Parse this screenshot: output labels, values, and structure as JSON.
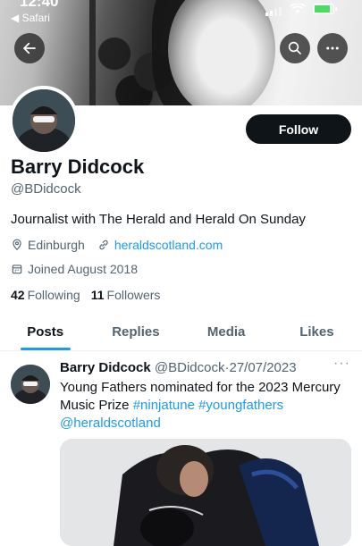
{
  "status_bar": {
    "time": "12:40",
    "back_app": "◀ Safari",
    "battery_color": "#4cd964"
  },
  "header": {
    "back_icon": "arrow-left-icon",
    "search_icon": "search-icon",
    "more_icon": "more-horizontal-icon"
  },
  "profile": {
    "name": "Barry Didcock",
    "handle": "@BDidcock",
    "bio": "Journalist with The Herald and Herald On Sunday",
    "location": "Edinburgh",
    "website": "heraldscotland.com",
    "joined": "Joined August 2018",
    "following_count": "42",
    "following_label": "Following",
    "followers_count": "11",
    "followers_label": "Followers",
    "follow_label": "Follow"
  },
  "tabs": [
    {
      "label": "Posts",
      "active": true
    },
    {
      "label": "Replies",
      "active": false
    },
    {
      "label": "Media",
      "active": false
    },
    {
      "label": "Likes",
      "active": false
    }
  ],
  "tweet": {
    "author_name": "Barry Didcock",
    "author_handle": "@BDidcock",
    "separator": "·",
    "date": "27/07/2023",
    "more": "···",
    "text_1": "Young Fathers nominated for the 2023 Mercury Music Prize ",
    "tag_1": "#ninjatune",
    "tag_2": "#youngfathers",
    "tag_3": "@heraldscotland"
  },
  "colors": {
    "accent": "#1d9bf0",
    "text_primary": "#0f1419",
    "text_secondary": "#536471",
    "button_dark": "#0f1419"
  }
}
